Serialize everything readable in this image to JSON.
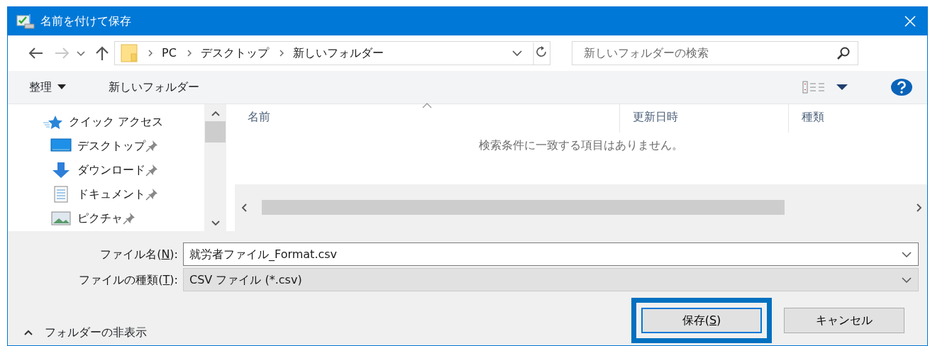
{
  "window": {
    "title": "名前を付けて保存"
  },
  "navigation": {
    "back": {
      "disabled": false
    },
    "forward": {
      "disabled": true
    }
  },
  "address": {
    "breadcrumbs": [
      "PC",
      "デスクトップ",
      "新しいフォルダー"
    ]
  },
  "search": {
    "placeholder": "新しいフォルダーの検索"
  },
  "toolbar": {
    "organize": "整理",
    "new_folder": "新しいフォルダー"
  },
  "sidebar": {
    "items": [
      {
        "label": "クイック アクセス",
        "children": [
          {
            "label": "デスクトップ",
            "pinned": true
          },
          {
            "label": "ダウンロード",
            "pinned": true
          },
          {
            "label": "ドキュメント",
            "pinned": true
          },
          {
            "label": "ピクチャ",
            "pinned": true
          }
        ]
      }
    ]
  },
  "table": {
    "columns": [
      {
        "label": "名前",
        "sorted": true
      },
      {
        "label": "更新日時",
        "sorted": false
      },
      {
        "label": "種類",
        "sorted": false
      }
    ],
    "empty_message": "検索条件に一致する項目はありません。"
  },
  "form": {
    "fields": [
      {
        "label": "ファイル名(",
        "access_key": "N",
        "label_after": "):",
        "value": "就労者ファイル_Format.csv",
        "kind": "combo"
      },
      {
        "label": "ファイルの種類(",
        "access_key": "T",
        "label_after": "):",
        "value": "CSV ファイル (*.csv)",
        "kind": "select"
      }
    ]
  },
  "hide_folders": "フォルダーの非表示",
  "buttons": [
    {
      "label": "保存(",
      "access_key": "S",
      "label_after": ")",
      "default": true,
      "highlighted": true
    },
    {
      "label": "キャンセル",
      "default": false,
      "highlighted": false
    }
  ]
}
